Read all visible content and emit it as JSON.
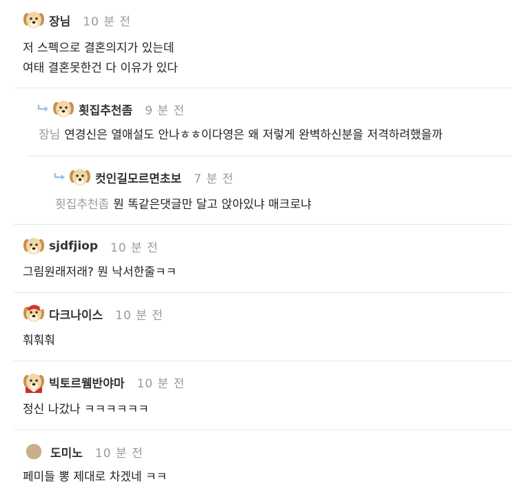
{
  "comments": [
    {
      "nickname": "장님",
      "time": "10 분 전",
      "avatar": "puppy-icon",
      "lines": [
        "저 스펙으로 결혼의지가 있는데",
        "여태 결혼못한건 다 이유가 있다"
      ]
    },
    {
      "nickname": "횟집추천좀",
      "time": "9 분 전",
      "avatar": "puppy-icon",
      "mention": "장님",
      "text": "연경신은 열애설도 안나ㅎㅎ이다영은 왜 저렇게 완벽하신분을 저격하려했을까"
    },
    {
      "nickname": "컷인길모르면초보",
      "time": "7 분 전",
      "avatar": "puppy-icon",
      "mention": "횟집추천좀",
      "text": "뭔 똑같은댓글만 달고 앉아있냐 매크로냐"
    },
    {
      "nickname": "sjdfjiop",
      "time": "10 분 전",
      "avatar": "puppy-icon",
      "text": "그림원래저래? 뭔 낙서한줄ㅋㅋ"
    },
    {
      "nickname": "다크나이스",
      "time": "10 분 전",
      "avatar": "puppy-red-hat-icon",
      "text": "훠훠훠"
    },
    {
      "nickname": "빅토르웸반야마",
      "time": "10 분 전",
      "avatar": "puppy-red-cape-icon",
      "text": "정신 나갔나 ㅋㅋㅋㅋㅋㅋ"
    },
    {
      "nickname": "도미노",
      "time": "10 분 전",
      "avatar": "tan-circle-icon",
      "text": "페미들 뽕 제대로 차겠네 ㅋㅋ"
    }
  ],
  "colors": {
    "nickname": "#333333",
    "time": "#999999",
    "mention": "#999999",
    "divider": "#e6e6e6"
  }
}
